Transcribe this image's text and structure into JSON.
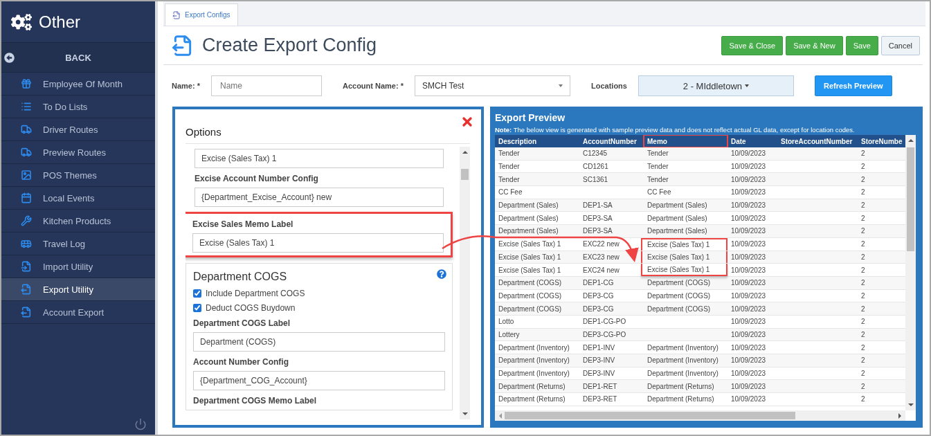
{
  "sidebar": {
    "title": "Other",
    "back": "BACK",
    "items": [
      {
        "label": "Employee Of Month",
        "selected": false
      },
      {
        "label": "To Do Lists",
        "selected": false
      },
      {
        "label": "Driver Routes",
        "selected": false
      },
      {
        "label": "Preview Routes",
        "selected": false
      },
      {
        "label": "POS Themes",
        "selected": false
      },
      {
        "label": "Local Events",
        "selected": false
      },
      {
        "label": "Kitchen Products",
        "selected": false
      },
      {
        "label": "Travel Log",
        "selected": false
      },
      {
        "label": "Import Utility",
        "selected": false
      },
      {
        "label": "Export Utility",
        "selected": true
      },
      {
        "label": "Account Export",
        "selected": false
      }
    ]
  },
  "tabs": [
    {
      "label": "Export Configs",
      "selected": true
    }
  ],
  "page": {
    "title": "Create Export Config",
    "buttons": [
      {
        "label": "Save & Close",
        "kind": "primary"
      },
      {
        "label": "Save & New",
        "kind": "primary"
      },
      {
        "label": "Save",
        "kind": "primary"
      },
      {
        "label": "Cancel",
        "kind": "default"
      }
    ]
  },
  "form": {
    "name": {
      "label": "Name: *",
      "placeholder": "Name"
    },
    "account": {
      "label": "Account Name: *",
      "value": "SMCH Test"
    },
    "locations": {
      "label": "Locations",
      "value": "2 - MIddletown"
    },
    "refresh": "Refresh Preview"
  },
  "options": {
    "title": "Options",
    "blocks": [
      {
        "kind": "fields",
        "highlighted": false,
        "items": [
          {
            "kind": "input",
            "value": "Excise (Sales Tax) 1"
          },
          {
            "kind": "label",
            "text": "Excise Account Number Config"
          },
          {
            "kind": "input",
            "value": "{Department_Excise_Account} new"
          }
        ]
      },
      {
        "kind": "fields",
        "highlighted": true,
        "items": [
          {
            "kind": "label",
            "text": "Excise Sales Memo Label"
          },
          {
            "kind": "input",
            "value": "Excise (Sales Tax) 1"
          }
        ]
      },
      {
        "kind": "card",
        "title": "Department COGS",
        "items": [
          {
            "kind": "checkbox",
            "text": "Include Department COGS",
            "checked": true
          },
          {
            "kind": "checkbox",
            "text": "Deduct COGS Buydown",
            "checked": true
          },
          {
            "kind": "label",
            "text": "Department COGS Label"
          },
          {
            "kind": "input",
            "value": "Department (COGS)"
          },
          {
            "kind": "label",
            "text": "Account Number Config"
          },
          {
            "kind": "input",
            "value": "{Department_COG_Account}"
          },
          {
            "kind": "label",
            "text": "Department COGS Memo Label"
          }
        ]
      }
    ]
  },
  "preview": {
    "title": "Export Preview",
    "note": "**Note:** The below view is generated with sample preview data and does not reflect actual GL data, except for location codes.",
    "columns": [
      {
        "label": "Description",
        "highlighted": false
      },
      {
        "label": "AccountNumber",
        "highlighted": false
      },
      {
        "label": "Memo",
        "highlighted": true
      },
      {
        "label": "Date",
        "highlighted": false
      },
      {
        "label": "StoreAccountNumber",
        "highlighted": false
      },
      {
        "label": "StoreNumbe",
        "highlighted": false
      }
    ],
    "rows": [
      {
        "highlighted": false,
        "cells": [
          "Tender",
          "C12345",
          "Tender",
          "10/09/2023",
          "",
          "2"
        ]
      },
      {
        "highlighted": false,
        "cells": [
          "Tender",
          "CD1261",
          "Tender",
          "10/09/2023",
          "",
          "2"
        ]
      },
      {
        "highlighted": false,
        "cells": [
          "Tender",
          "SC1361",
          "Tender",
          "10/09/2023",
          "",
          "2"
        ]
      },
      {
        "highlighted": false,
        "cells": [
          "CC Fee",
          "",
          "CC Fee",
          "10/09/2023",
          "",
          "2"
        ]
      },
      {
        "highlighted": false,
        "cells": [
          "Department (Sales)",
          "DEP1-SA",
          "Department (Sales)",
          "10/09/2023",
          "",
          "2"
        ]
      },
      {
        "highlighted": false,
        "cells": [
          "Department (Sales)",
          "DEP3-SA",
          "Department (Sales)",
          "10/09/2023",
          "",
          "2"
        ]
      },
      {
        "highlighted": false,
        "cells": [
          "Department (Sales)",
          "DEP3-SA",
          "Department (Sales)",
          "10/09/2023",
          "",
          "2"
        ]
      },
      {
        "highlighted": true,
        "cells": [
          "Excise (Sales Tax) 1",
          "EXC22 new",
          "Excise (Sales Tax) 1",
          "10/09/2023",
          "",
          "2"
        ]
      },
      {
        "highlighted": true,
        "cells": [
          "Excise (Sales Tax) 1",
          "EXC23 new",
          "Excise (Sales Tax) 1",
          "10/09/2023",
          "",
          "2"
        ]
      },
      {
        "highlighted": true,
        "cells": [
          "Excise (Sales Tax) 1",
          "EXC24 new",
          "Excise (Sales Tax) 1",
          "10/09/2023",
          "",
          "2"
        ]
      },
      {
        "highlighted": false,
        "cells": [
          "Department (COGS)",
          "DEP1-CG",
          "Department (COGS)",
          "10/09/2023",
          "",
          "2"
        ]
      },
      {
        "highlighted": false,
        "cells": [
          "Department (COGS)",
          "DEP3-CG",
          "Department (COGS)",
          "10/09/2023",
          "",
          "2"
        ]
      },
      {
        "highlighted": false,
        "cells": [
          "Department (COGS)",
          "DEP3-CG",
          "Department (COGS)",
          "10/09/2023",
          "",
          "2"
        ]
      },
      {
        "highlighted": false,
        "cells": [
          "Lotto",
          "DEP1-CG-PO",
          "",
          "10/09/2023",
          "",
          "2"
        ]
      },
      {
        "highlighted": false,
        "cells": [
          "Lottery",
          "DEP3-CG-PO",
          "",
          "10/09/2023",
          "",
          "2"
        ]
      },
      {
        "highlighted": false,
        "cells": [
          "Department (Inventory)",
          "DEP1-INV",
          "Department (Inventory)",
          "10/09/2023",
          "",
          "2"
        ]
      },
      {
        "highlighted": false,
        "cells": [
          "Department (Inventory)",
          "DEP3-INV",
          "Department (Inventory)",
          "10/09/2023",
          "",
          "2"
        ]
      },
      {
        "highlighted": false,
        "cells": [
          "Department (Inventory)",
          "DEP3-INV",
          "Department (Inventory)",
          "10/09/2023",
          "",
          "2"
        ]
      },
      {
        "highlighted": false,
        "cells": [
          "Department (Returns)",
          "DEP1-RET",
          "Department (Returns)",
          "10/09/2023",
          "",
          "2"
        ]
      },
      {
        "highlighted": false,
        "cells": [
          "Department (Returns)",
          "DEP3-RET",
          "Department (Returns)",
          "10/09/2023",
          "",
          "2"
        ]
      }
    ]
  }
}
